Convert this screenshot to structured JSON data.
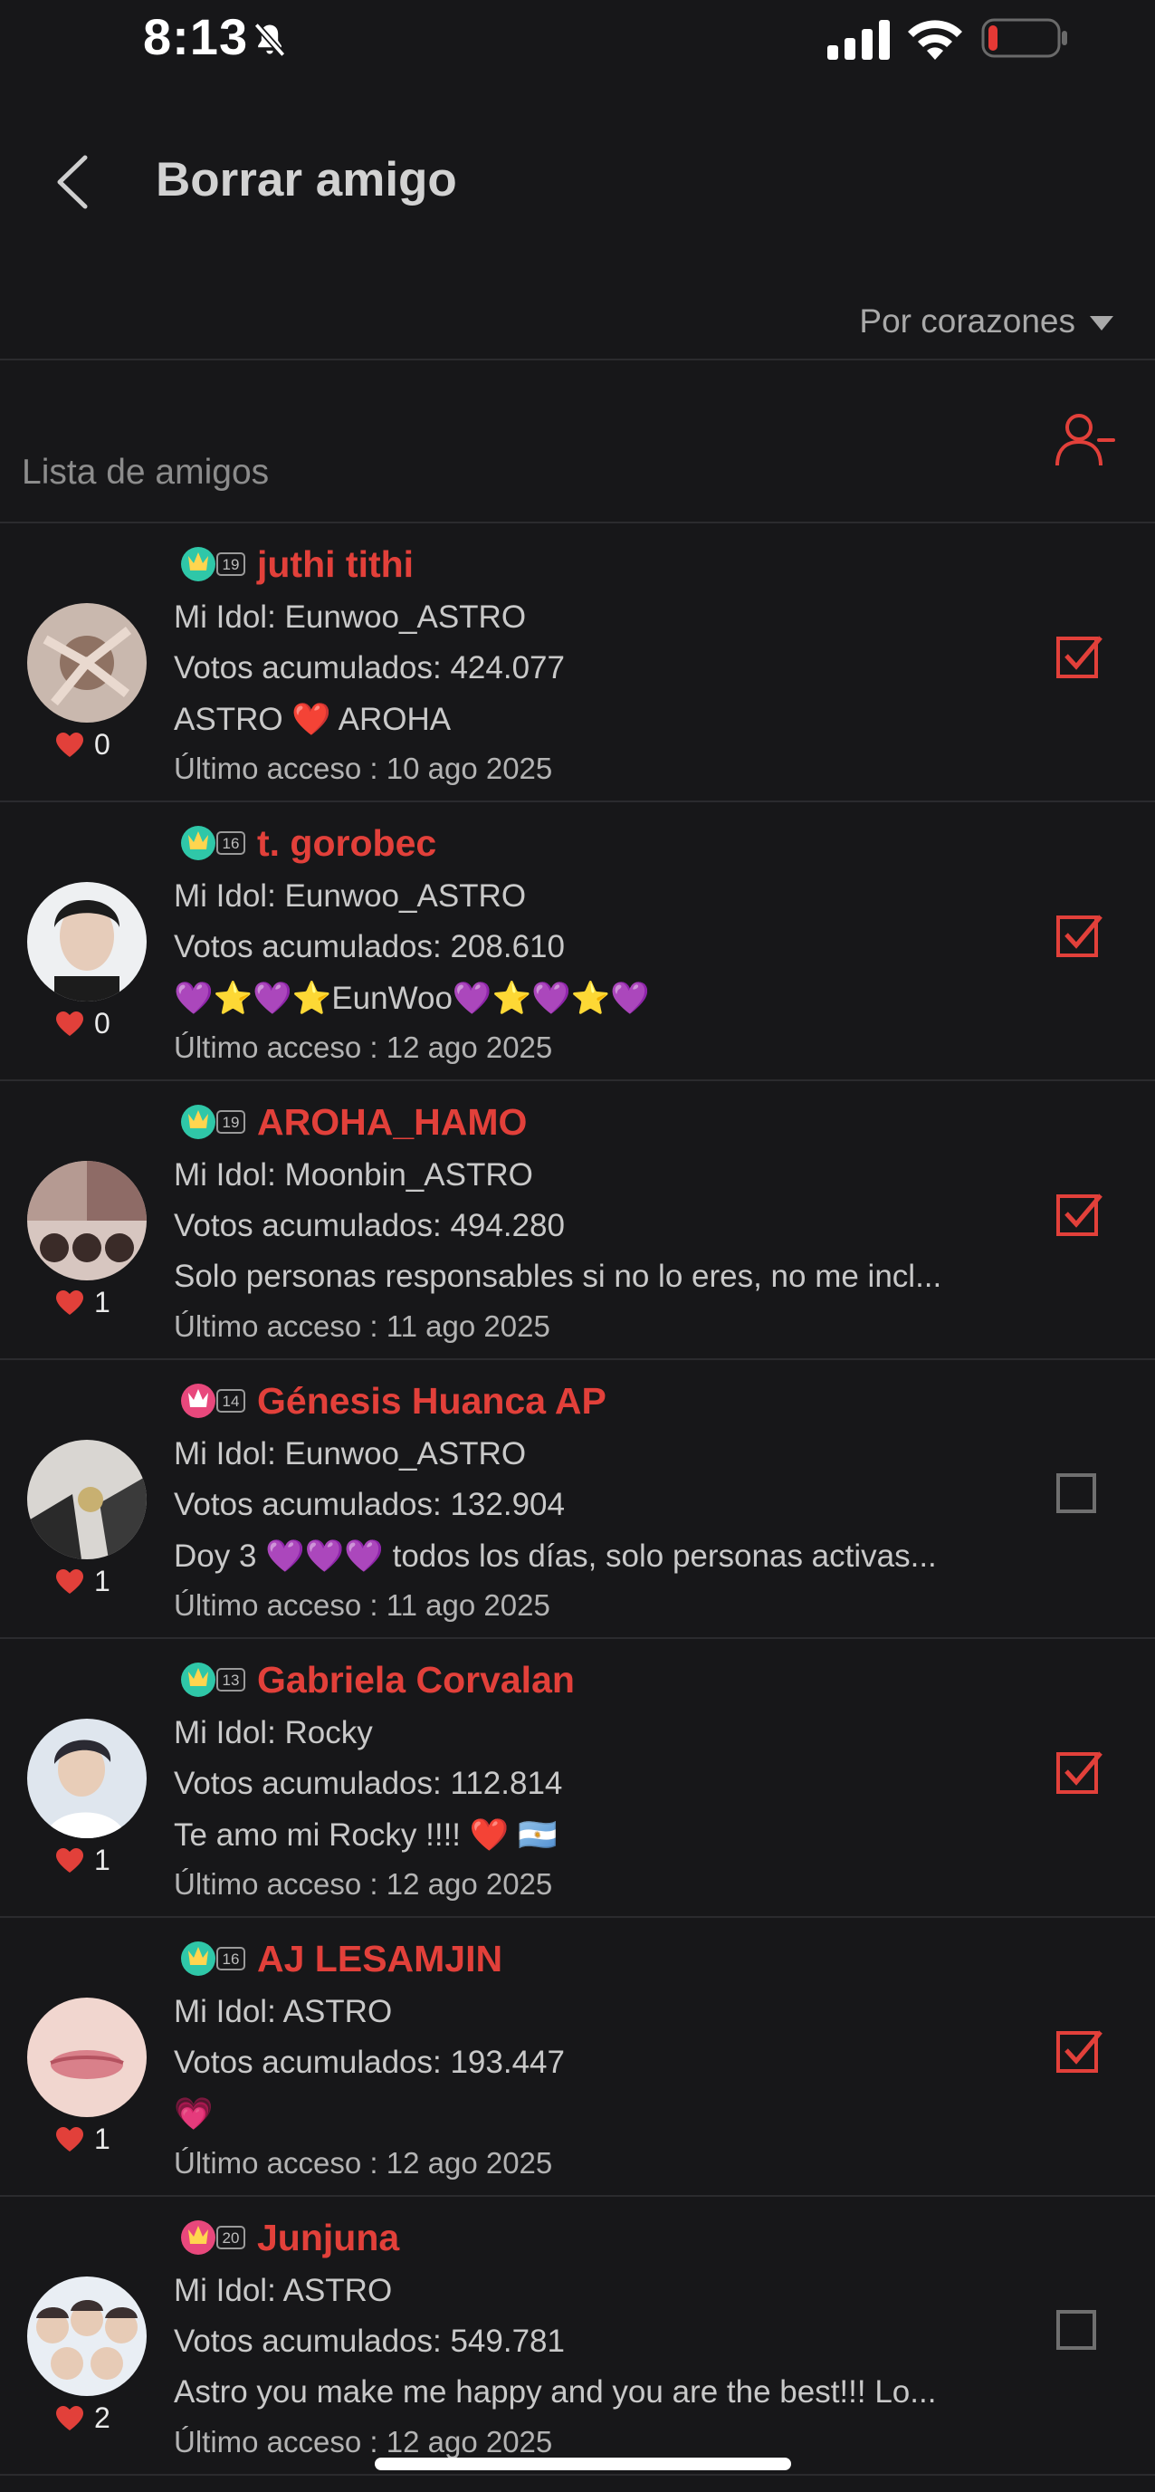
{
  "status": {
    "time": "8:13",
    "icons": [
      "bell-mute-icon",
      "signal-icon",
      "wifi-icon",
      "battery-icon"
    ],
    "battery_color": "#e53935"
  },
  "header": {
    "title": "Borrar amigo"
  },
  "sort": {
    "label": "Por corazones"
  },
  "friends_list": {
    "label": "Lista de amigos",
    "action_icon": "remove-user-icon"
  },
  "accent_color": "#e2403a",
  "friends": [
    {
      "level": "19",
      "name": "juthi tithi",
      "idol": "Mi Idol: Eunwoo_ASTRO",
      "votes": "Votos acumulados: 424.077",
      "bio": "ASTRO ❤️ AROHA",
      "last": "Último acceso : 10 ago 2025",
      "hearts": "0",
      "checked": true,
      "badge_color": "#2fc7a8"
    },
    {
      "level": "16",
      "name": "t. gorobec",
      "idol": "Mi Idol: Eunwoo_ASTRO",
      "votes": "Votos acumulados: 208.610",
      "bio": "💜⭐💜⭐EunWoo💜⭐💜⭐💜",
      "last": "Último acceso : 12 ago 2025",
      "hearts": "0",
      "checked": true,
      "badge_color": "#2fc7a8"
    },
    {
      "level": "19",
      "name": "AROHA_HAMO",
      "idol": "Mi Idol: Moonbin_ASTRO",
      "votes": "Votos acumulados: 494.280",
      "bio": "Solo personas responsables si no lo eres, no me incl...",
      "last": "Último acceso : 11 ago 2025",
      "hearts": "1",
      "checked": true,
      "badge_color": "#2fc7a8"
    },
    {
      "level": "14",
      "name": "Génesis Huanca AP",
      "idol": "Mi Idol: Eunwoo_ASTRO",
      "votes": "Votos acumulados: 132.904",
      "bio": "Doy 3 💜💜💜 todos los días, solo personas activas...",
      "last": "Último acceso : 11 ago 2025",
      "hearts": "1",
      "checked": false,
      "badge_color": "#e8487c"
    },
    {
      "level": "13",
      "name": "Gabriela Corvalan",
      "idol": "Mi Idol: Rocky",
      "votes": "Votos acumulados: 112.814",
      "bio": "Te amo mi Rocky !!!! ❤️ 🇦🇷",
      "last": "Último acceso : 12 ago 2025",
      "hearts": "1",
      "checked": true,
      "badge_color": "#2fc7a8"
    },
    {
      "level": "16",
      "name": "AJ LESAMJIN",
      "idol": "Mi Idol: ASTRO",
      "votes": "Votos acumulados: 193.447",
      "bio": "💗",
      "last": "Último acceso : 12 ago 2025",
      "hearts": "1",
      "checked": true,
      "badge_color": "#2fc7a8"
    },
    {
      "level": "20",
      "name": "Junjuna",
      "idol": "Mi Idol: ASTRO",
      "votes": "Votos acumulados: 549.781",
      "bio": "Astro you make me happy and you are the best!!! Lo...",
      "last": "Último acceso : 12 ago 2025",
      "hearts": "2",
      "checked": false,
      "badge_color": "#e8487c"
    }
  ]
}
